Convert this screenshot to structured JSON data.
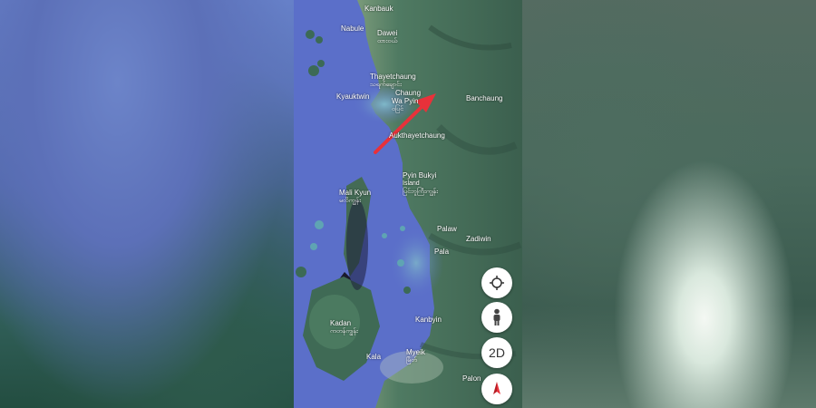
{
  "map": {
    "labels": {
      "kanbauk": "Kanbauk",
      "nabule": "Nabule",
      "dawei": "Dawei",
      "dawei_my": "ထားဝယ်",
      "thayetchaung": "Thayetchaung",
      "thayetchaung_my": "သရက်ချောင်း",
      "chaung": "Chaung",
      "wa_pyin": "Wa Pyin",
      "wa_pyin_my": "ဝပြင်",
      "kyauktwin": "Kyauktwin",
      "banchaung": "Banchaung",
      "aukthayetchaung": "Aukthayetchaung",
      "pyin_bukyi": "Pyin Bukyi",
      "island": "Island",
      "pyin_bukyi_my": "ပြင်ဘူကြီးကျွန်း",
      "mali_kyun": "Mali Kyun",
      "mali_kyun_my": "မလိကျွန်း",
      "palaw": "Palaw",
      "zadiwin": "Zadiwin",
      "pala": "Pala",
      "kadan": "Kadan",
      "kadan_my": "ကတန်ကျွန်း",
      "kanbyin": "Kanbyin",
      "myeik": "Myeik",
      "myeik_my": "မြိတ်",
      "kala": "Kala",
      "palon": "Palon"
    },
    "controls": {
      "view_mode": "2D"
    },
    "colors": {
      "sea": "#5b6fc9",
      "land": "#3e6a57",
      "arrow": "#e8313a",
      "compass_red": "#e8313a"
    }
  }
}
